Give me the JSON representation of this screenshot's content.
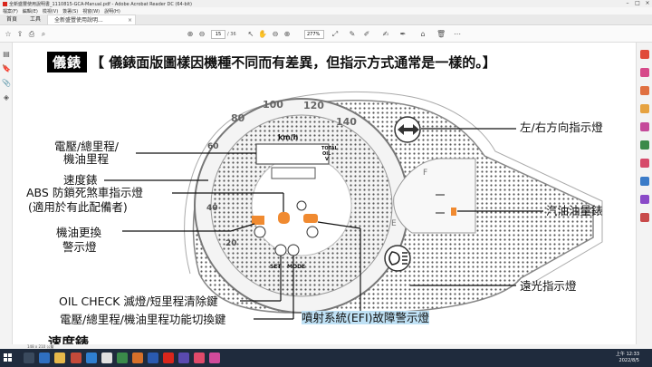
{
  "window": {
    "title": "全新盛豐使用說明書_1110815-GCA-Manual.pdf - Adobe Acrobat Reader DC (64-bit)"
  },
  "menu": [
    "檔案(F)",
    "編輯(E)",
    "檢視(V)",
    "簽署(S)",
    "視窗(W)",
    "說明(H)"
  ],
  "tabs": {
    "home": "首頁",
    "tools": "工具",
    "document": "全新盛豐使用說明..."
  },
  "toolbar": {
    "page_current": "15",
    "page_total": "/ 36",
    "zoom": "277%"
  },
  "statusbar": {
    "page_size": "148 x 210 公釐"
  },
  "document": {
    "heading_tag": "儀錶",
    "heading_text": "【 儀錶面版圖樣因機種不同而有差異，但指示方式通常是一樣的。】",
    "section_title": "速度錶",
    "labels": {
      "odometer_1": "電壓/總里程/",
      "odometer_2": "機油里程",
      "speedometer": "速度錶",
      "abs_1": "ABS 防鎖死煞車指示燈",
      "abs_2": "(適用於有此配備者)",
      "oil_change_1": "機油更換",
      "oil_change_2": "警示燈",
      "oil_check_button": "OIL CHECK 滅燈/短里程清除鍵",
      "mode_button": "電壓/總里程/機油里程功能切換鍵",
      "efi": "噴射系統(EFI)故障警示燈",
      "turn_signal": "左/右方向指示燈",
      "fuel_gauge": "汽油油量錶",
      "high_beam": "遠光指示燈"
    },
    "gauge": {
      "ticks": [
        "20",
        "40",
        "60",
        "80",
        "100",
        "120",
        "140"
      ],
      "unit": "km/h",
      "total_1": "TOTAL",
      "total_2": "OIL",
      "total_3": "V",
      "set_label": "SET",
      "mode_label": "MODE",
      "fuel_full": "F",
      "fuel_empty": "E"
    }
  },
  "clock": {
    "time": "上午 12:33",
    "date": "2022/8/5"
  }
}
